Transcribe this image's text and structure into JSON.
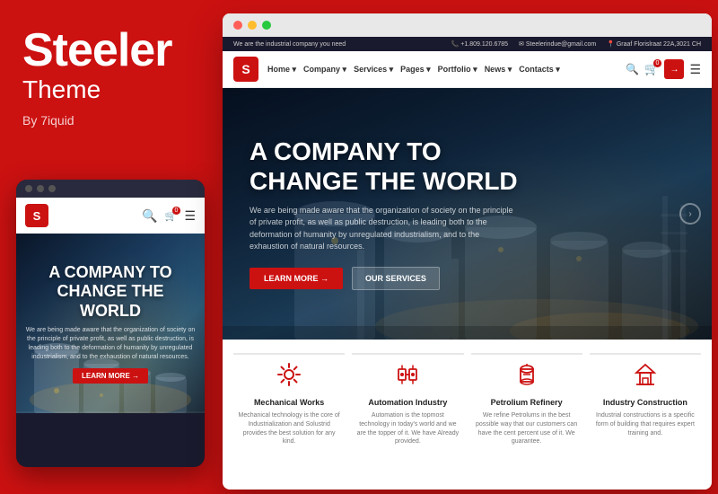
{
  "brand": {
    "title": "Steeler",
    "subtitle": "Theme",
    "by": "By 7iquid"
  },
  "browser": {
    "dots": [
      "red",
      "yellow",
      "green"
    ]
  },
  "topbar": {
    "tagline": "We are the industrial company you need",
    "phone": "+1.809.120.6785",
    "email": "Steelerindue@gmail.com",
    "address": "Graaf Florislraat 22A,3021 CH"
  },
  "site_nav": {
    "logo": "S",
    "items": [
      {
        "label": "Home ▾"
      },
      {
        "label": "Company ▾"
      },
      {
        "label": "Services ▾"
      },
      {
        "label": "Pages ▾"
      },
      {
        "label": "Portfolio ▾"
      },
      {
        "label": "News ▾"
      },
      {
        "label": "Contacts ▾"
      }
    ]
  },
  "hero": {
    "title": "A COMPANY TO CHANGE THE WORLD",
    "description": "We are being made aware that the organization of society on the principle of private profit, as well as public destruction, is leading both to the deformation of humanity by unregulated industrialism, and to the exhaustion of natural resources.",
    "btn_primary": "LEARN MORE →",
    "btn_secondary": "OUR SERVICES"
  },
  "mobile_hero": {
    "title": "A COMPANY TO CHANGE THE WORLD",
    "description": "We are being made aware that the organization of society on the principle of private profit, as well as public destruction, is leading both to the deformation of humanity by unregulated industrialism, and to the exhaustion of natural resources.",
    "btn_label": "LEARN MORE →"
  },
  "services": [
    {
      "icon": "⚙",
      "name": "Mechanical Works",
      "desc": "Mechanical technology is the core of Industrialization and Solustrid provides the best solution for any kind."
    },
    {
      "icon": "🔧",
      "name": "Automation Industry",
      "desc": "Automation is the topmost technology in today's world and we are the topper of it. We have Already provided."
    },
    {
      "icon": "🛢",
      "name": "Petrolium Refinery",
      "desc": "We refine Petrolums in the best possible way that our customers can have the cent percent use of it. We guarantee."
    },
    {
      "icon": "🏗",
      "name": "Industry Construction",
      "desc": "Industrial constructions is a specific form of building that requires expert training and."
    }
  ],
  "colors": {
    "brand_red": "#cc1111",
    "dark_bg": "#0d2035",
    "text_light": "#ffffff"
  }
}
